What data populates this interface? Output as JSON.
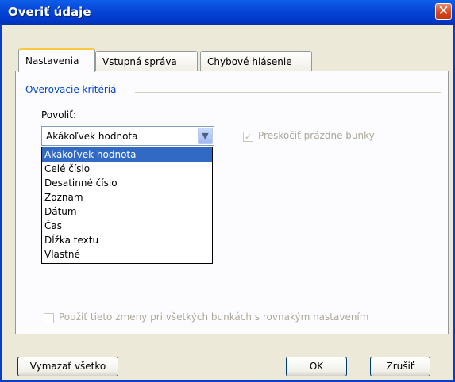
{
  "window": {
    "title": "Overiť údaje",
    "close_label": "✕"
  },
  "tabs": [
    {
      "label": "Nastavenia"
    },
    {
      "label": "Vstupná správa"
    },
    {
      "label": "Chybové hlásenie"
    }
  ],
  "criteria": {
    "group_label": "Overovacie kritériá",
    "allow_label": "Povoliť:",
    "allow_selected": "Akákoľvek hodnota",
    "allow_options": [
      "Akákoľvek hodnota",
      "Celé číslo",
      "Desatinné číslo",
      "Zoznam",
      "Dátum",
      "Čas",
      "Dĺžka textu",
      "Vlastné"
    ],
    "ignore_blank_label": "Preskočiť prázdne bunky",
    "ignore_blank_checked": true,
    "apply_all_label": "Použiť tieto zmeny pri všetkých bunkách s rovnakým nastavením",
    "apply_all_checked": false
  },
  "buttons": {
    "clear_all": "Vymazať všetko",
    "ok": "OK",
    "cancel": "Zrušiť"
  },
  "colors": {
    "title_bar": "#0746d9",
    "group_label": "#0046d5",
    "selection": "#316ac5",
    "active_tab_accent": "#ffc83c"
  }
}
